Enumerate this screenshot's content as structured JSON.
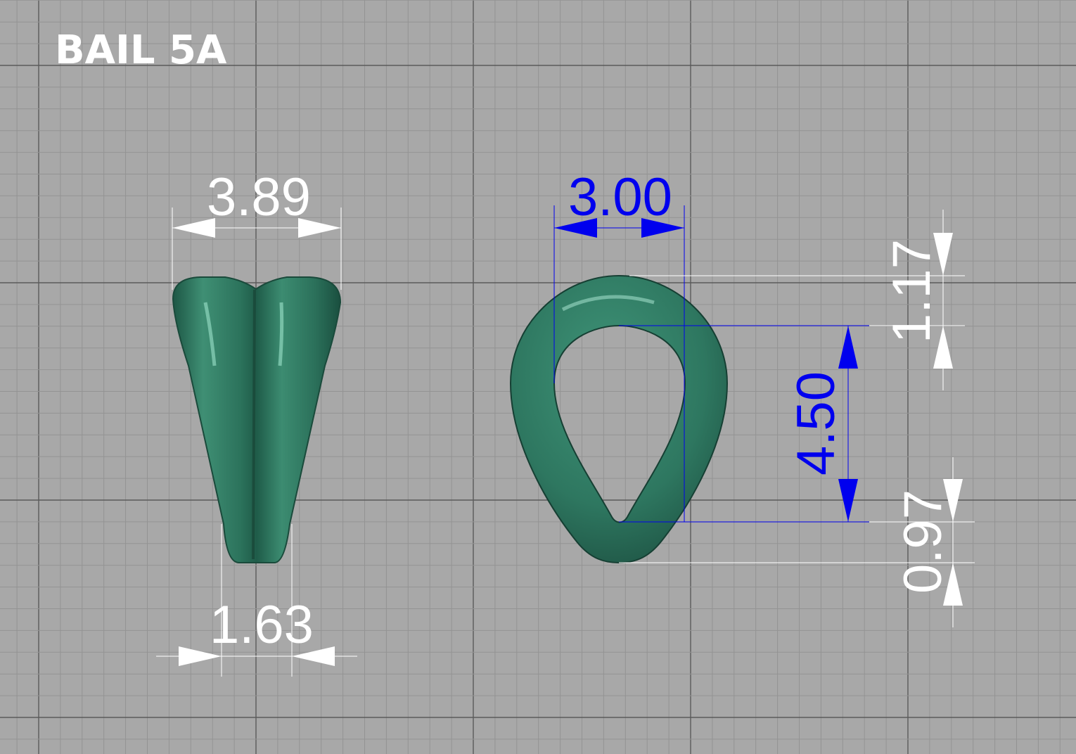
{
  "title": "BAIL 5A",
  "colors": {
    "background": "#a8a8a8",
    "grid_minor": "#939393",
    "grid_major": "#5a5a5a",
    "model_green": "#2f7a62",
    "dimension_white": "#ffffff",
    "dimension_blue": "#0000ee"
  },
  "side_view": {
    "top_width": "3.89",
    "bottom_width": "1.63"
  },
  "front_view": {
    "inner_width": "3.00",
    "inner_height": "4.50",
    "top_thickness": "1.17",
    "bottom_thickness": "0.97"
  }
}
